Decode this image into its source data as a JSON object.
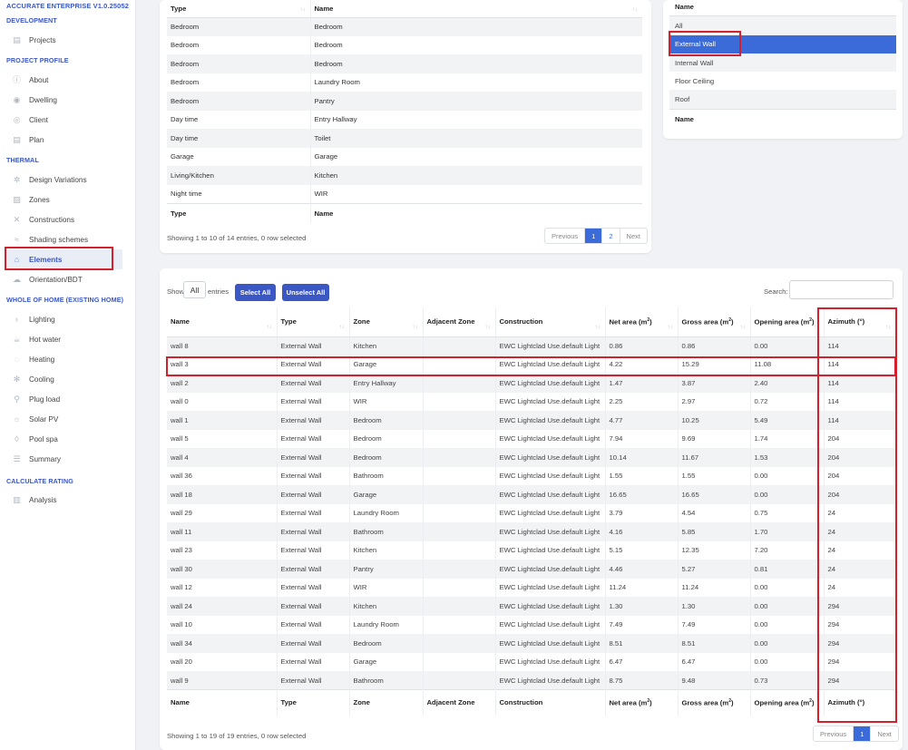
{
  "app": {
    "title": "ACCURATE ENTERPRISE V1.0.25052"
  },
  "sidebar": {
    "sections": [
      {
        "title": "DEVELOPMENT",
        "items": [
          {
            "label": "Projects",
            "icon": "clipboard-icon"
          }
        ]
      },
      {
        "title": "PROJECT PROFILE",
        "items": [
          {
            "label": "About",
            "icon": "info-icon"
          },
          {
            "label": "Dwelling",
            "icon": "location-pin-icon"
          },
          {
            "label": "Client",
            "icon": "user-icon"
          },
          {
            "label": "Plan",
            "icon": "document-icon"
          }
        ]
      },
      {
        "title": "THERMAL",
        "items": [
          {
            "label": "Design Variations",
            "icon": "gear-icon"
          },
          {
            "label": "Zones",
            "icon": "image-icon"
          },
          {
            "label": "Constructions",
            "icon": "tools-icon"
          },
          {
            "label": "Shading schemes",
            "icon": "waves-icon"
          },
          {
            "label": "Elements",
            "icon": "house-icon",
            "active": true
          },
          {
            "label": "Orientation/BDT",
            "icon": "cloud-icon"
          }
        ]
      },
      {
        "title": "WHOLE OF HOME (EXISTING HOME)",
        "items": [
          {
            "label": "Lighting",
            "icon": "bulb-icon"
          },
          {
            "label": "Hot water",
            "icon": "cup-icon"
          },
          {
            "label": "Heating",
            "icon": "flame-icon"
          },
          {
            "label": "Cooling",
            "icon": "snowflake-icon"
          },
          {
            "label": "Plug load",
            "icon": "plug-icon"
          },
          {
            "label": "Solar PV",
            "icon": "sun-icon"
          },
          {
            "label": "Pool spa",
            "icon": "drop-icon"
          },
          {
            "label": "Summary",
            "icon": "list-icon"
          }
        ]
      },
      {
        "title": "CALCULATE RATING",
        "items": [
          {
            "label": "Analysis",
            "icon": "bar-chart-icon"
          }
        ]
      }
    ]
  },
  "zone_types": {
    "columns": [
      "Type",
      "Name"
    ],
    "rows": [
      [
        "Bedroom",
        "Bedroom"
      ],
      [
        "Bedroom",
        "Bedroom"
      ],
      [
        "Bedroom",
        "Bedroom"
      ],
      [
        "Bedroom",
        "Laundry Room"
      ],
      [
        "Bedroom",
        "Pantry"
      ],
      [
        "Day time",
        "Entry Hallway"
      ],
      [
        "Day time",
        "Toilet"
      ],
      [
        "Garage",
        "Garage"
      ],
      [
        "Living/Kitchen",
        "Kitchen"
      ],
      [
        "Night time",
        "WIR"
      ]
    ],
    "info": "Showing 1 to 10 of 14 entries, 0 row selected",
    "pager": {
      "prev": "Previous",
      "pages": [
        "1",
        "2"
      ],
      "next": "Next"
    }
  },
  "element_filter": {
    "header": "Name",
    "items": [
      "All",
      "External Wall",
      "Internal Wall",
      "Floor Ceiling",
      "Roof"
    ],
    "selected": "External Wall",
    "footer": "Name"
  },
  "elements": {
    "show_label": "Show",
    "length_value": "All",
    "entries_label": "entries",
    "select_all": "Select All",
    "unselect_all": "Unselect All",
    "search_label": "Search:",
    "columns": [
      "Name",
      "Type",
      "Zone",
      "Adjacent Zone",
      "Construction",
      "Net area (m",
      "Gross area (m",
      "Opening area (m",
      "Azimuth (°)"
    ],
    "rows": [
      [
        "wall 8",
        "External Wall",
        "Kitchen",
        "",
        "EWC Lightclad Use.default Light",
        "0.86",
        "0.86",
        "0.00",
        "114"
      ],
      [
        "wall 3",
        "External Wall",
        "Garage",
        "",
        "EWC Lightclad Use.default Light",
        "4.22",
        "15.29",
        "11.08",
        "114"
      ],
      [
        "wall 2",
        "External Wall",
        "Entry Hallway",
        "",
        "EWC Lightclad Use.default Light",
        "1.47",
        "3.87",
        "2.40",
        "114"
      ],
      [
        "wall 0",
        "External Wall",
        "WIR",
        "",
        "EWC Lightclad Use.default Light",
        "2.25",
        "2.97",
        "0.72",
        "114"
      ],
      [
        "wall 1",
        "External Wall",
        "Bedroom",
        "",
        "EWC Lightclad Use.default Light",
        "4.77",
        "10.25",
        "5.49",
        "114"
      ],
      [
        "wall 5",
        "External Wall",
        "Bedroom",
        "",
        "EWC Lightclad Use.default Light",
        "7.94",
        "9.69",
        "1.74",
        "204"
      ],
      [
        "wall 4",
        "External Wall",
        "Bedroom",
        "",
        "EWC Lightclad Use.default Light",
        "10.14",
        "11.67",
        "1.53",
        "204"
      ],
      [
        "wall 36",
        "External Wall",
        "Bathroom",
        "",
        "EWC Lightclad Use.default Light",
        "1.55",
        "1.55",
        "0.00",
        "204"
      ],
      [
        "wall 18",
        "External Wall",
        "Garage",
        "",
        "EWC Lightclad Use.default Light",
        "16.65",
        "16.65",
        "0.00",
        "204"
      ],
      [
        "wall 29",
        "External Wall",
        "Laundry Room",
        "",
        "EWC Lightclad Use.default Light",
        "3.79",
        "4.54",
        "0.75",
        "24"
      ],
      [
        "wall 11",
        "External Wall",
        "Bathroom",
        "",
        "EWC Lightclad Use.default Light",
        "4.16",
        "5.85",
        "1.70",
        "24"
      ],
      [
        "wall 23",
        "External Wall",
        "Kitchen",
        "",
        "EWC Lightclad Use.default Light",
        "5.15",
        "12.35",
        "7.20",
        "24"
      ],
      [
        "wall 30",
        "External Wall",
        "Pantry",
        "",
        "EWC Lightclad Use.default Light",
        "4.46",
        "5.27",
        "0.81",
        "24"
      ],
      [
        "wall 12",
        "External Wall",
        "WIR",
        "",
        "EWC Lightclad Use.default Light",
        "11.24",
        "11.24",
        "0.00",
        "24"
      ],
      [
        "wall 24",
        "External Wall",
        "Kitchen",
        "",
        "EWC Lightclad Use.default Light",
        "1.30",
        "1.30",
        "0.00",
        "294"
      ],
      [
        "wall 10",
        "External Wall",
        "Laundry Room",
        "",
        "EWC Lightclad Use.default Light",
        "7.49",
        "7.49",
        "0.00",
        "294"
      ],
      [
        "wall 34",
        "External Wall",
        "Bedroom",
        "",
        "EWC Lightclad Use.default Light",
        "8.51",
        "8.51",
        "0.00",
        "294"
      ],
      [
        "wall 20",
        "External Wall",
        "Garage",
        "",
        "EWC Lightclad Use.default Light",
        "6.47",
        "6.47",
        "0.00",
        "294"
      ],
      [
        "wall 9",
        "External Wall",
        "Bathroom",
        "",
        "EWC Lightclad Use.default Light",
        "8.75",
        "9.48",
        "0.73",
        "294"
      ]
    ],
    "info": "Showing 1 to 19 of 19 entries, 0 row selected",
    "pager": {
      "prev": "Previous",
      "pages": [
        "1"
      ],
      "next": "Next"
    }
  },
  "colors": {
    "accent": "#3b57c4",
    "selected": "#3b6bd9",
    "highlight": "#d2202d"
  }
}
